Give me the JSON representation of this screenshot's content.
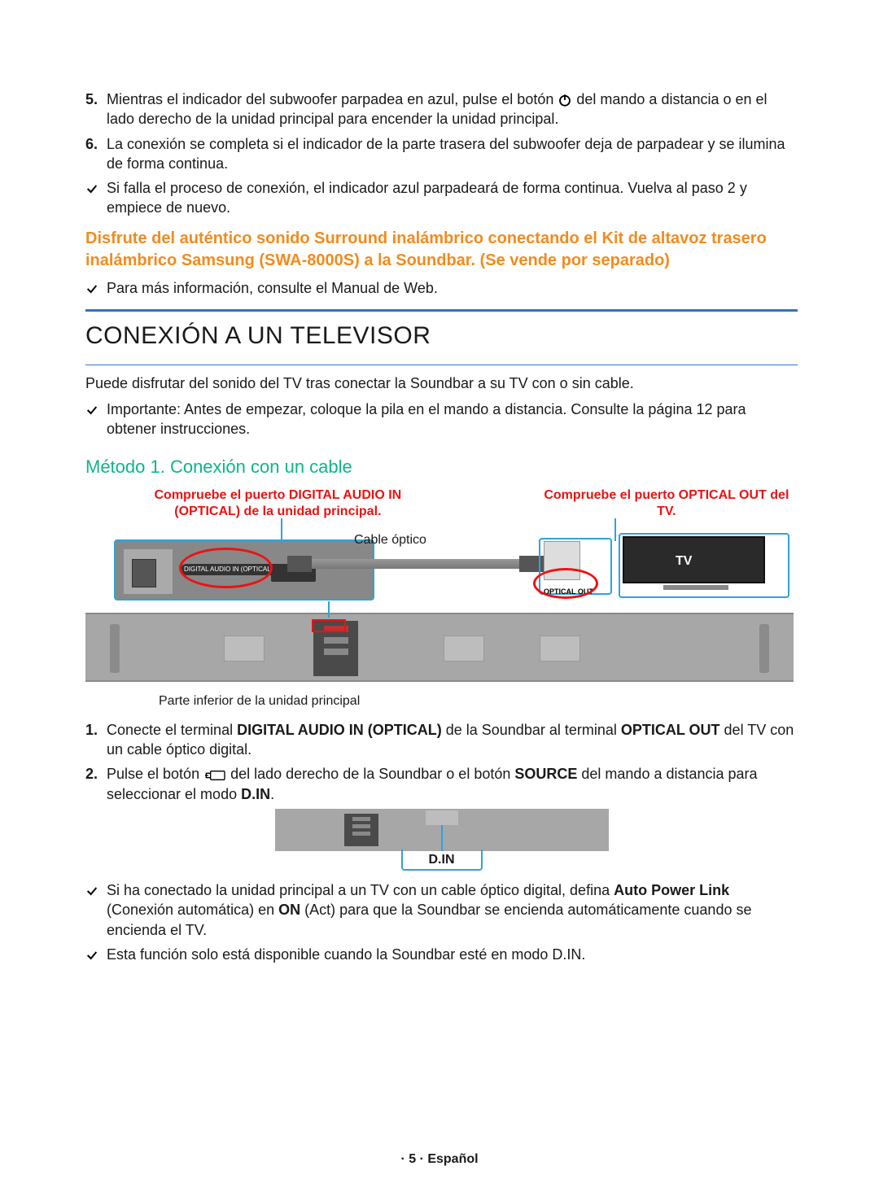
{
  "top_list": {
    "item5": {
      "num": "5.",
      "before": "Mientras el indicador del subwoofer parpadea en azul, pulse el botón ",
      "after": " del mando a distancia o en el lado derecho de la unidad principal para encender la unidad principal."
    },
    "item6": {
      "num": "6.",
      "text": "La conexión se completa si el indicador de la parte trasera del subwoofer deja de parpadear y se ilumina de forma continua."
    },
    "check1": "Si falla el proceso de conexión, el indicador azul parpadeará de forma continua. Vuelva al paso 2 y empiece de nuevo."
  },
  "orange_block": "Disfrute del auténtico sonido Surround inalámbrico conectando el Kit de altavoz trasero inalámbrico Samsung (SWA-8000S) a la Soundbar. (Se vende por separado)",
  "check_web": "Para más información, consulte el Manual de Web.",
  "section_title": "CONEXIÓN A UN TELEVISOR",
  "section_intro": "Puede disfrutar del sonido del TV tras conectar la Soundbar a su TV con o sin cable.",
  "check_importante": "Importante: Antes de empezar, coloque la pila en el mando a distancia. Consulte la página 12 para obtener instrucciones.",
  "method_title": "Método 1. Conexión con un cable",
  "diagram": {
    "label_left": "Compruebe el puerto DIGITAL AUDIO IN (OPTICAL) de la unidad principal.",
    "label_right": "Compruebe el puerto OPTICAL OUT del TV.",
    "cable": "Cable óptico",
    "port_label": "DIGITAL AUDIO IN (OPTICAL)",
    "tv": "TV",
    "optical_out": "OPTICAL OUT",
    "caption": "Parte inferior de la unidad principal"
  },
  "steps": {
    "s1": {
      "num": "1.",
      "a": "Conecte el terminal ",
      "b": "DIGITAL AUDIO IN (OPTICAL)",
      "c": " de la Soundbar al terminal ",
      "d": "OPTICAL OUT",
      "e": " del TV con un cable óptico digital."
    },
    "s2": {
      "num": "2.",
      "a": "Pulse el botón ",
      "b": " del lado derecho de la Soundbar o el botón ",
      "c": "SOURCE",
      "d": " del mando a distancia para seleccionar el modo ",
      "e": "D.IN",
      "f": "."
    }
  },
  "din_label": "D.IN",
  "bottom_checks": {
    "c1a": "Si ha conectado la unidad principal a un TV con un cable óptico digital, defina ",
    "c1b": "Auto Power Link",
    "c1c": " (Conexión automática) en ",
    "c1d": "ON",
    "c1e": " (Act) para que la Soundbar se encienda automáticamente cuando se encienda el TV.",
    "c2": "Esta función solo está disponible cuando la Soundbar esté en modo D.IN."
  },
  "footer": "· 5 · Español"
}
